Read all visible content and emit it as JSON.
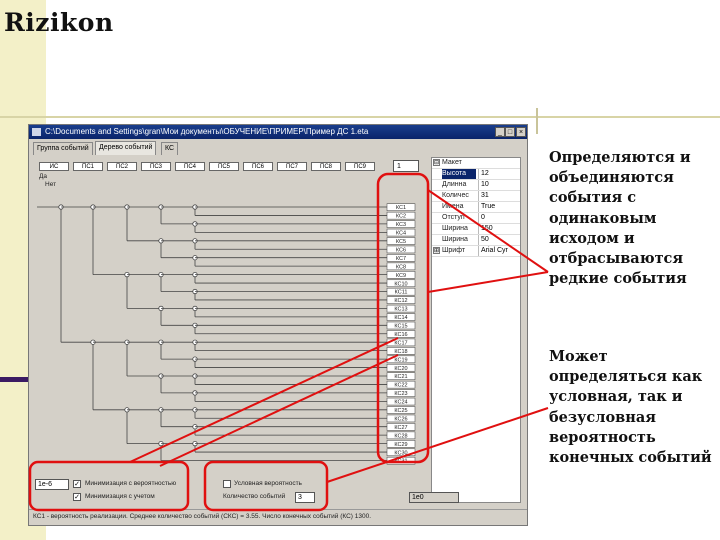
{
  "logo": {
    "text": "Rizikon"
  },
  "window": {
    "title": "C:\\Documents and Settings\\gran\\Мои документы\\ОБУЧЕНИЕ\\ПРИМЕР\\Пример ДС 1.eta",
    "tabs": [
      "Группа событий",
      "Дерево событий",
      "КС"
    ],
    "header_cells": [
      "ИС",
      "ПС1",
      "ПС2",
      "ПС3",
      "ПС4",
      "ПС5",
      "ПС6",
      "ПС7",
      "ПС8",
      "ПС9"
    ],
    "spin_value": "1",
    "left_markers": [
      "Да",
      "Нет"
    ],
    "outcomes": [
      "КС1",
      "КС2",
      "КС3",
      "КС4",
      "КС5",
      "КС6",
      "КС7",
      "КС8",
      "КС9",
      "КС10",
      "КС11",
      "КС12",
      "КС13",
      "КС14",
      "КС15",
      "КС16",
      "КС17",
      "КС18",
      "КС19",
      "КС20",
      "КС21",
      "КС22",
      "КС23",
      "КС24",
      "КС25",
      "КС26",
      "КС27",
      "КС28",
      "КС29",
      "КС30",
      "КС31"
    ],
    "properties": [
      {
        "name": "Макет",
        "value": "",
        "expand": "⊟"
      },
      {
        "name": "Высота",
        "value": "12",
        "selected": true
      },
      {
        "name": "Длинна",
        "value": "10"
      },
      {
        "name": "Количес",
        "value": "31"
      },
      {
        "name": "Имена",
        "value": "True"
      },
      {
        "name": "Отступ",
        "value": "0"
      },
      {
        "name": "Ширина",
        "value": "150"
      },
      {
        "name": "Ширина",
        "value": "50"
      },
      {
        "name": "Шрифт",
        "value": "Arial Cyr",
        "expand": "⊞"
      }
    ],
    "minimize_value": "1e-6",
    "checkbox1_label": "Минимизация с вероятностью",
    "checkbox2_label": "Минимизация с учетом",
    "conditional_label": "Условная вероятность",
    "count_label": "Количество событий",
    "count_value": "3",
    "prob_value": "1e0",
    "status_text": "КС1 - вероятность реализации. Среднее количество событий (СКС) = 3.55. Число конечных событий (КС) 1300.",
    "buttons": {
      "minimize": "_",
      "maximize": "□",
      "close": "×"
    }
  },
  "annotations": {
    "top": "Определяются и объединяются события с одинаковым исходом и отбрасываются редкие события",
    "bottom": "Может определяться как условная, так и безусловная вероятность конечных событий"
  },
  "colors": {
    "highlight": "#e01010",
    "title_bar": "#0a246a",
    "band": "#f3f0c8",
    "accent": "#3b1b63"
  }
}
